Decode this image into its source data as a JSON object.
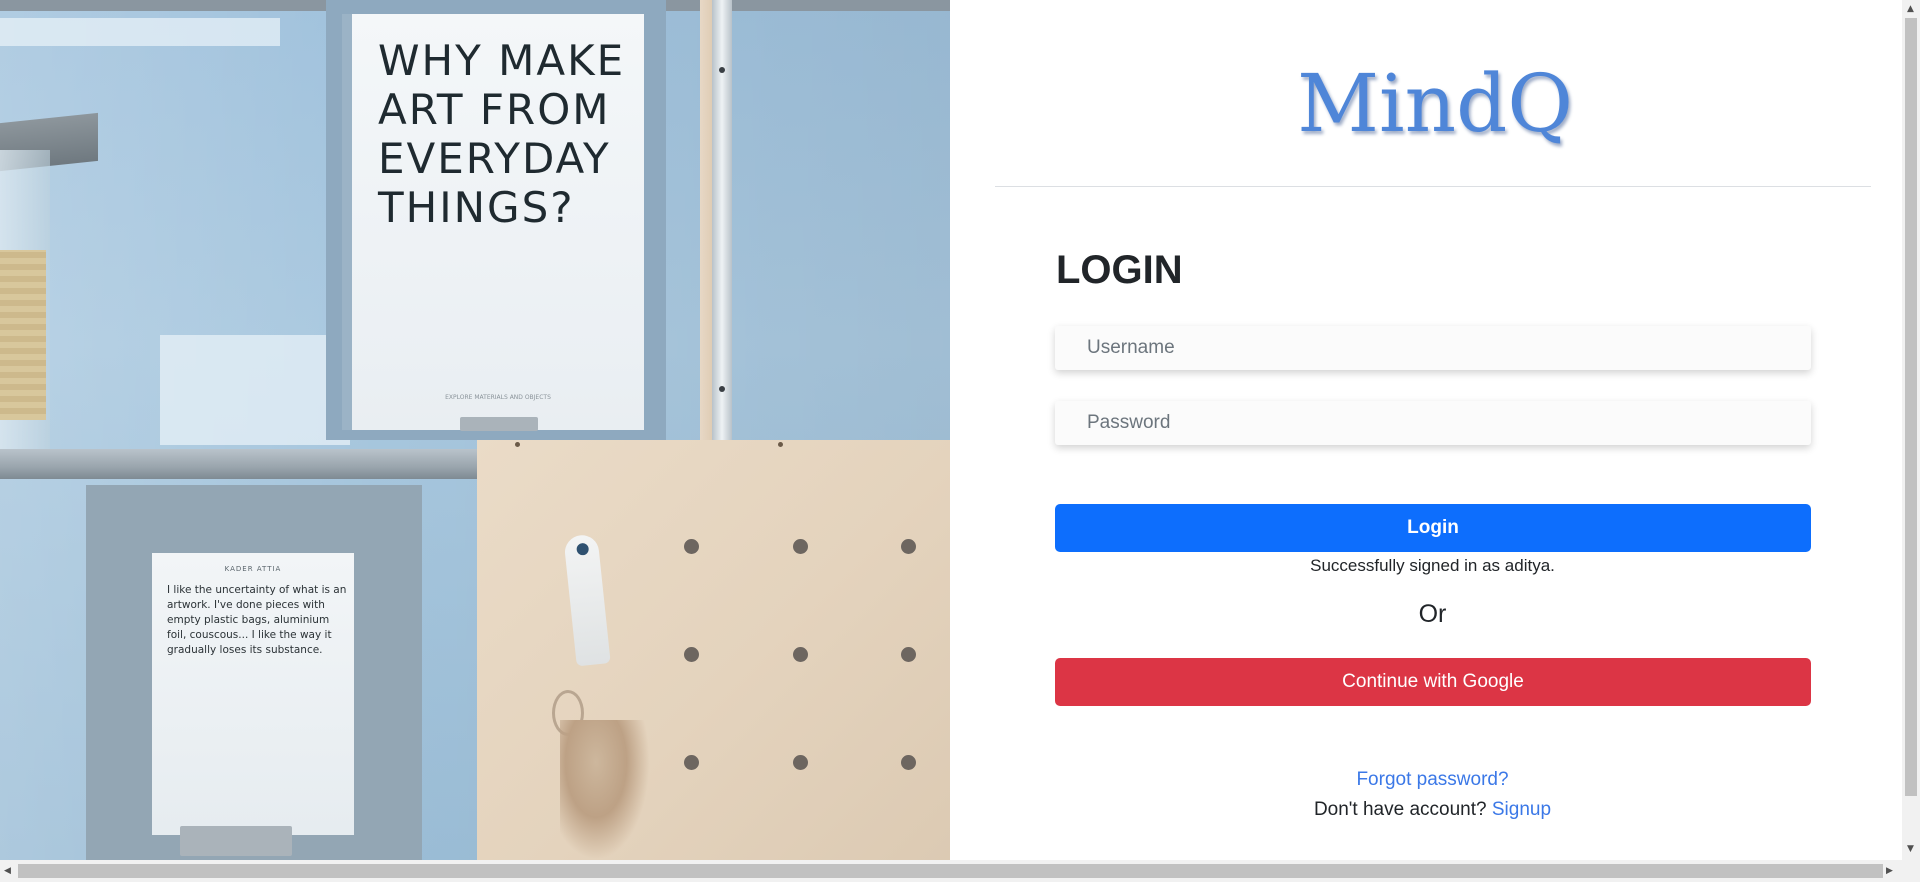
{
  "hero_image": {
    "poster_main_text": "WHY MAKE ART FROM EVERYDAY THINGS?",
    "poster_main_footer": "EXPLORE MATERIALS AND OBJECTS",
    "poster_small_title": "KADER ATTIA",
    "poster_small_text": "I like the uncertainty of what is an artwork. I've done pieces with empty plastic bags, aluminium foil, couscous... I like the way it gradually loses its substance."
  },
  "brand": {
    "name": "MindQ",
    "color": "#4f86d8"
  },
  "login_form": {
    "heading": "LOGIN",
    "username_placeholder": "Username",
    "password_placeholder": "Password",
    "submit_label": "Login",
    "status_message": "Successfully signed in as aditya.",
    "separator": "Or",
    "google_label": "Continue with Google",
    "forgot_password": "Forgot password?",
    "no_account_text": "Don't have account?",
    "signup_link": "Signup"
  },
  "colors": {
    "primary": "#0d6efd",
    "danger": "#dc3545",
    "link": "#3b78e7"
  },
  "scrollbars": {
    "up_arrow": "▲",
    "down_arrow": "▼",
    "left_arrow": "◀",
    "right_arrow": "▶"
  }
}
